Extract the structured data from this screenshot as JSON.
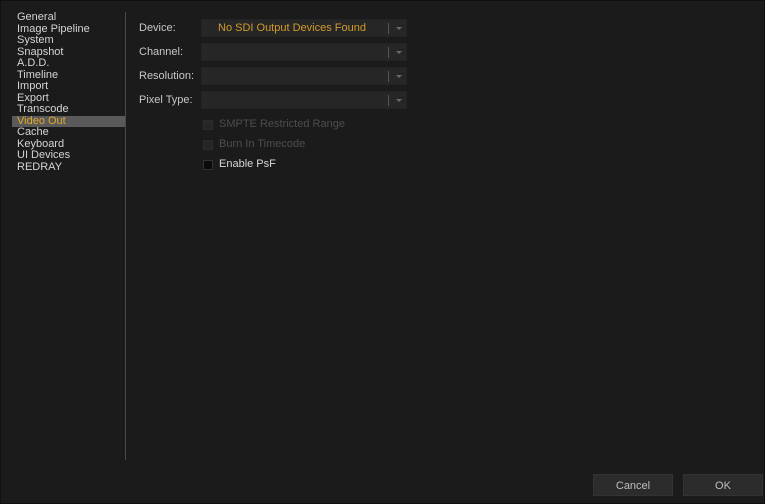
{
  "sidebar": {
    "items": [
      {
        "label": "General"
      },
      {
        "label": "Image Pipeline"
      },
      {
        "label": "System"
      },
      {
        "label": "Snapshot"
      },
      {
        "label": "A.D.D."
      },
      {
        "label": "Timeline"
      },
      {
        "label": "Import"
      },
      {
        "label": "Export"
      },
      {
        "label": "Transcode"
      },
      {
        "label": "Video Out"
      },
      {
        "label": "Cache"
      },
      {
        "label": "Keyboard"
      },
      {
        "label": "UI Devices"
      },
      {
        "label": "REDRAY"
      }
    ],
    "selected_index": 9
  },
  "form": {
    "device": {
      "label": "Device:",
      "value": "No SDI Output Devices Found"
    },
    "channel": {
      "label": "Channel:",
      "value": ""
    },
    "resolution": {
      "label": "Resolution:",
      "value": ""
    },
    "pixel_type": {
      "label": "Pixel Type:",
      "value": ""
    }
  },
  "checkboxes": {
    "smpte_restricted_range": {
      "label": "SMPTE Restricted Range",
      "enabled": false,
      "checked": false
    },
    "burn_in_timecode": {
      "label": "Burn In Timecode",
      "enabled": false,
      "checked": false
    },
    "enable_psf": {
      "label": "Enable PsF",
      "enabled": true,
      "checked": false
    }
  },
  "footer": {
    "cancel_label": "Cancel",
    "ok_label": "OK"
  },
  "colors": {
    "accent": "#d29b2a",
    "background": "#1b1b1b",
    "selected_bg": "#5a5a5a"
  }
}
